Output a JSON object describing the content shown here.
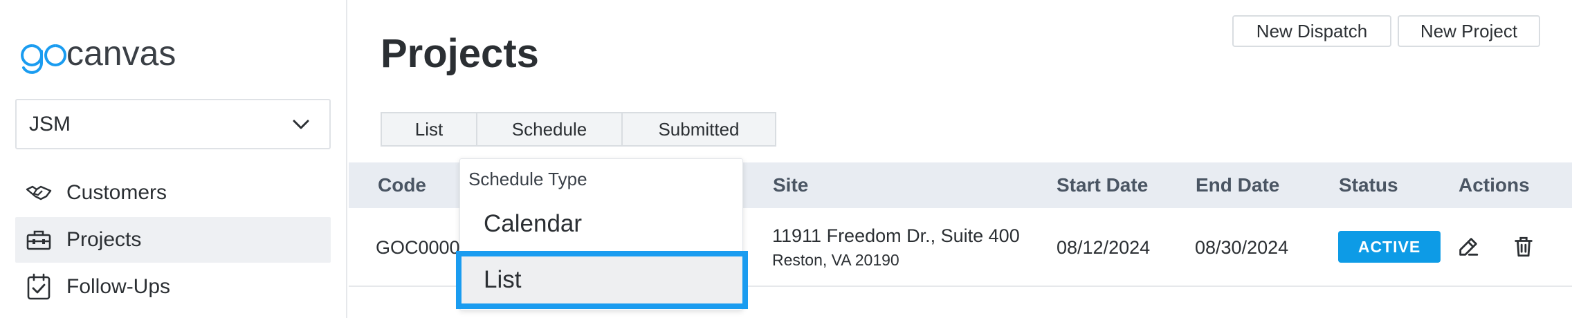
{
  "app": {
    "logo_text": "gocanvas"
  },
  "sidebar": {
    "account": "JSM",
    "items": [
      {
        "label": "Customers",
        "icon": "handshake-icon"
      },
      {
        "label": "Projects",
        "icon": "toolbox-icon",
        "active": true
      },
      {
        "label": "Follow-Ups",
        "icon": "calendar-check-icon"
      }
    ]
  },
  "header": {
    "title": "Projects",
    "new_dispatch": "New Dispatch",
    "new_project": "New Project"
  },
  "tabs": [
    "List",
    "Schedule",
    "Submitted"
  ],
  "table": {
    "columns": {
      "code": "Code",
      "site": "Site",
      "start": "Start Date",
      "end": "End Date",
      "status": "Status",
      "actions": "Actions"
    },
    "rows": [
      {
        "code": "GOC0000",
        "site_line1": "11911 Freedom Dr., Suite 400",
        "site_line2": "Reston, VA 20190",
        "start": "08/12/2024",
        "end": "08/30/2024",
        "status": "ACTIVE"
      }
    ]
  },
  "dropdown": {
    "header": "Schedule Type",
    "options": [
      "Calendar",
      "List"
    ],
    "highlighted": "List"
  },
  "colors": {
    "accent": "#0d9be6",
    "highlight_border": "#1a9cf0",
    "header_bg": "#e8ecf2"
  }
}
